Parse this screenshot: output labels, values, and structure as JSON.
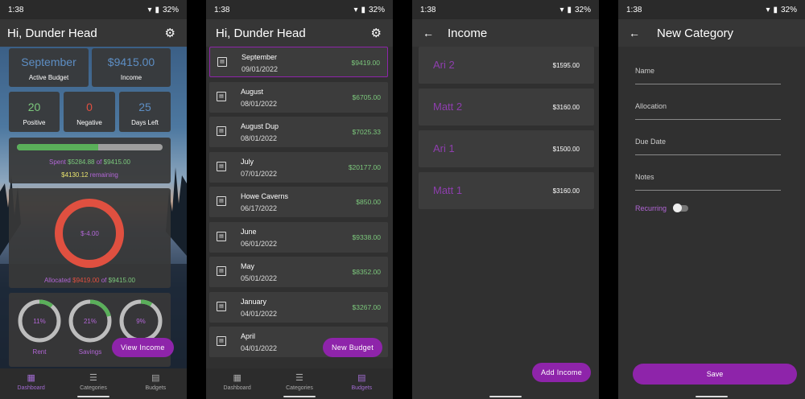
{
  "status": {
    "time": "1:38",
    "battery": "32%"
  },
  "nav": {
    "dashboard": "Dashboard",
    "categories": "Categories",
    "budgets": "Budgets"
  },
  "dashboard": {
    "greeting": "Hi, Dunder Head",
    "month": "September",
    "month_label": "Active Budget",
    "income": "$9415.00",
    "income_label": "Income",
    "positive": "20",
    "positive_label": "Positive",
    "negative": "0",
    "negative_label": "Negative",
    "days_left": "25",
    "days_left_label": "Days Left",
    "spent_fraction": 0.56,
    "spent_prefix": "Spent",
    "spent": "$5284.88",
    "spent_of": "of",
    "spent_total": "$9415.00",
    "remaining": "$4130.12",
    "remaining_label": "remaining",
    "donut_value": "$-4.00",
    "allocated_prefix": "Allocated",
    "allocated": "$9419.00",
    "allocated_of": "of",
    "allocated_total": "$9415.00",
    "rings": [
      {
        "label": "Rent",
        "value": "11%",
        "fraction": 0.11
      },
      {
        "label": "Savings",
        "value": "21%",
        "fraction": 0.21
      },
      {
        "label": "",
        "value": "9%",
        "fraction": 0.09
      }
    ],
    "view_income": "View Income"
  },
  "budgets": {
    "greeting": "Hi, Dunder Head",
    "items": [
      {
        "name": "September",
        "date": "09/01/2022",
        "amount": "$9419.00"
      },
      {
        "name": "August",
        "date": "08/01/2022",
        "amount": "$6705.00"
      },
      {
        "name": "August Dup",
        "date": "08/01/2022",
        "amount": "$7025.33"
      },
      {
        "name": "July",
        "date": "07/01/2022",
        "amount": "$20177.00"
      },
      {
        "name": "Howe Caverns",
        "date": "06/17/2022",
        "amount": "$850.00"
      },
      {
        "name": "June",
        "date": "06/01/2022",
        "amount": "$9338.00"
      },
      {
        "name": "May",
        "date": "05/01/2022",
        "amount": "$8352.00"
      },
      {
        "name": "January",
        "date": "04/01/2022",
        "amount": "$3267.00"
      },
      {
        "name": "April",
        "date": "04/01/2022",
        "amount": ""
      }
    ],
    "new_budget": "New Budget"
  },
  "income": {
    "title": "Income",
    "items": [
      {
        "name": "Ari 2",
        "amount": "$1595.00"
      },
      {
        "name": "Matt 2",
        "amount": "$3160.00"
      },
      {
        "name": "Ari 1",
        "amount": "$1500.00"
      },
      {
        "name": "Matt 1",
        "amount": "$3160.00"
      }
    ],
    "add_income": "Add Income"
  },
  "new_category": {
    "title": "New Category",
    "fields": [
      "Name",
      "Allocation",
      "Due Date",
      "Notes"
    ],
    "recurring": "Recurring",
    "save": "Save"
  },
  "colors": {
    "accent": "#8e24aa",
    "green": "#7cc87c",
    "red": "#e05040",
    "blue": "#5d8ec4"
  }
}
